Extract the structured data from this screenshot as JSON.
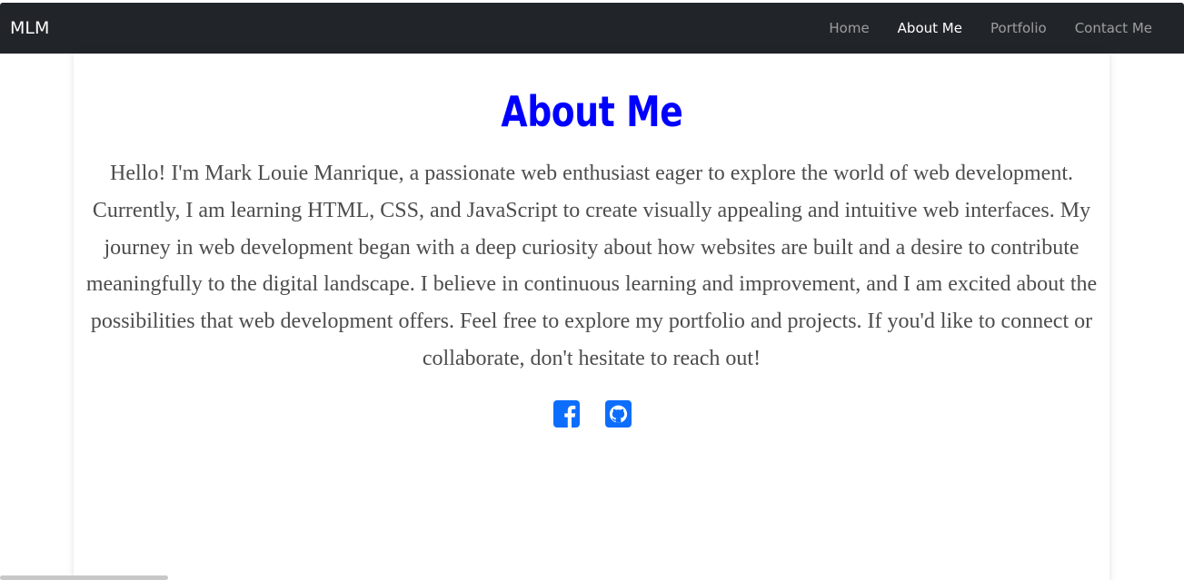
{
  "navbar": {
    "brand": "MLM",
    "links": [
      {
        "label": "Home",
        "active": false
      },
      {
        "label": "About Me",
        "active": true
      },
      {
        "label": "Portfolio",
        "active": false
      },
      {
        "label": "Contact Me",
        "active": false
      }
    ]
  },
  "main": {
    "title": "About Me",
    "bio": "Hello! I'm Mark Louie Manrique, a passionate web enthusiast eager to explore the world of web development. Currently, I am learning HTML, CSS, and JavaScript to create visually appealing and intuitive web interfaces. My journey in web development began with a deep curiosity about how websites are built and a desire to contribute meaningfully to the digital landscape. I believe in continuous learning and improvement, and I am excited about the possibilities that web development offers. Feel free to explore my portfolio and projects. If you'd like to connect or collaborate, don't hesitate to reach out!",
    "social": [
      {
        "icon": "facebook-icon"
      },
      {
        "icon": "github-icon"
      }
    ]
  },
  "colors": {
    "navbar_bg": "#212529",
    "title": "#0000ff",
    "icon": "#0d6efd",
    "text": "#4d4d4d"
  }
}
